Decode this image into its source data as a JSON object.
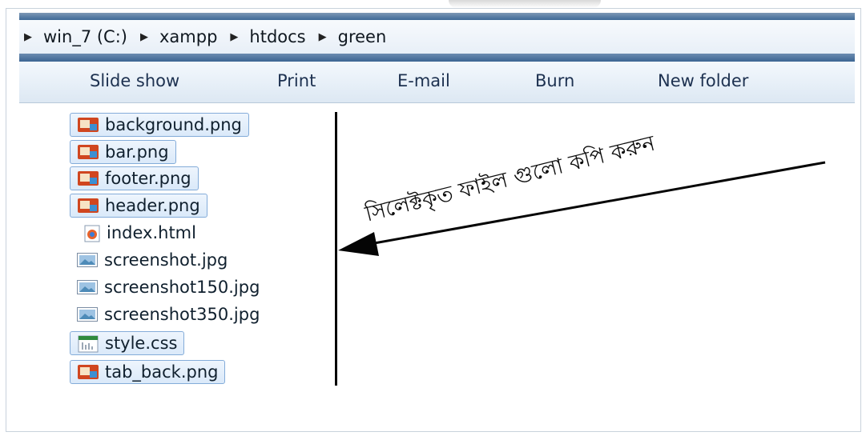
{
  "breadcrumb": {
    "items": [
      "win_7 (C:)",
      "xampp",
      "htdocs",
      "green"
    ]
  },
  "toolbar": {
    "buttons": [
      "Slide show",
      "Print",
      "E-mail",
      "Burn",
      "New folder"
    ]
  },
  "files": [
    {
      "name": "background.png",
      "icon": "png-image-icon",
      "selected": true
    },
    {
      "name": "bar.png",
      "icon": "png-image-icon",
      "selected": true
    },
    {
      "name": "footer.png",
      "icon": "png-image-icon",
      "selected": true
    },
    {
      "name": "header.png",
      "icon": "png-image-icon",
      "selected": true
    },
    {
      "name": "index.html",
      "icon": "html-file-icon",
      "selected": false
    },
    {
      "name": "screenshot.jpg",
      "icon": "jpg-image-icon",
      "selected": false
    },
    {
      "name": "screenshot150.jpg",
      "icon": "jpg-image-icon",
      "selected": false
    },
    {
      "name": "screenshot350.jpg",
      "icon": "jpg-image-icon",
      "selected": false
    },
    {
      "name": "style.css",
      "icon": "css-file-icon",
      "selected": true
    },
    {
      "name": "tab_back.png",
      "icon": "png-image-icon",
      "selected": true
    }
  ],
  "annotation": {
    "text": "সিলেক্টকৃত ফাইল গুলো কপি করুন"
  },
  "colors": {
    "selection_border": "#84acd9",
    "title_bar": "#3f6a97",
    "annotation": "#0b0b0b"
  }
}
